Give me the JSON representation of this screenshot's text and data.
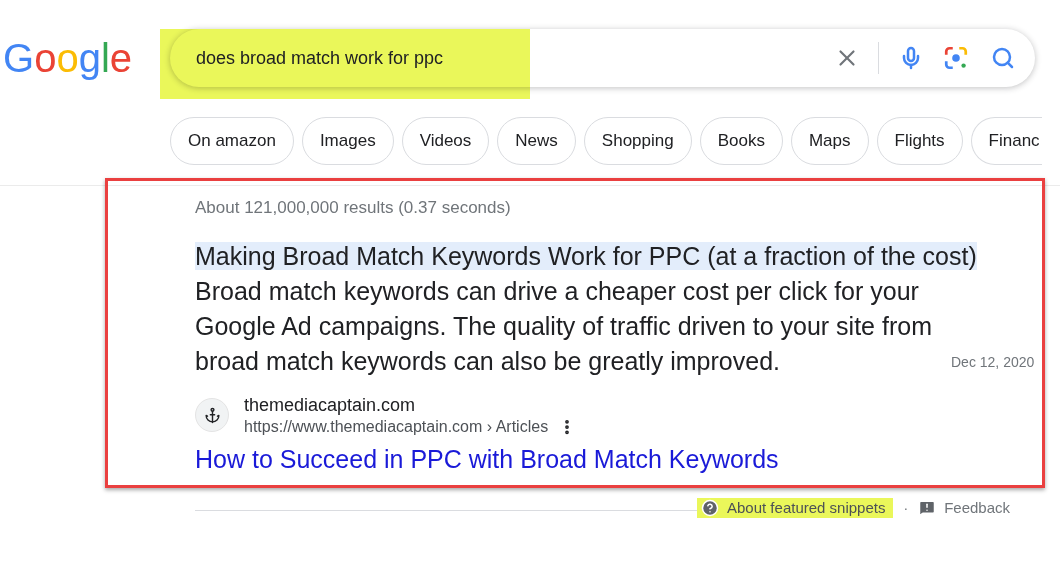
{
  "logo": "Google",
  "search": {
    "value": "does broad match work for ppc",
    "highlighted": true
  },
  "chips": [
    {
      "label": "On amazon",
      "cut": false
    },
    {
      "label": "Images",
      "cut": false
    },
    {
      "label": "Videos",
      "cut": false
    },
    {
      "label": "News",
      "cut": false
    },
    {
      "label": "Shopping",
      "cut": false
    },
    {
      "label": "Books",
      "cut": false
    },
    {
      "label": "Maps",
      "cut": false
    },
    {
      "label": "Flights",
      "cut": false
    },
    {
      "label": "Financ",
      "cut": true
    }
  ],
  "results_count": "About 121,000,000 results (0.37 seconds)",
  "snippet": {
    "outlined": true,
    "title": "Making Broad Match Keywords Work for PPC (at a fraction of the cost)",
    "title_highlighted": true,
    "body": "Broad match keywords can drive a cheaper cost per click for your Google Ad campaigns. The quality of traffic driven to your site from broad match keywords can also be greatly improved.",
    "date": "Dec 12, 2020",
    "site": "themediacaptain.com",
    "url": "https://www.themediacaptain.com › Articles",
    "link": "How to Succeed in PPC with Broad Match Keywords"
  },
  "footer": {
    "about": "About featured snippets",
    "about_highlighted": true,
    "separator": "·",
    "feedback": "Feedback"
  }
}
